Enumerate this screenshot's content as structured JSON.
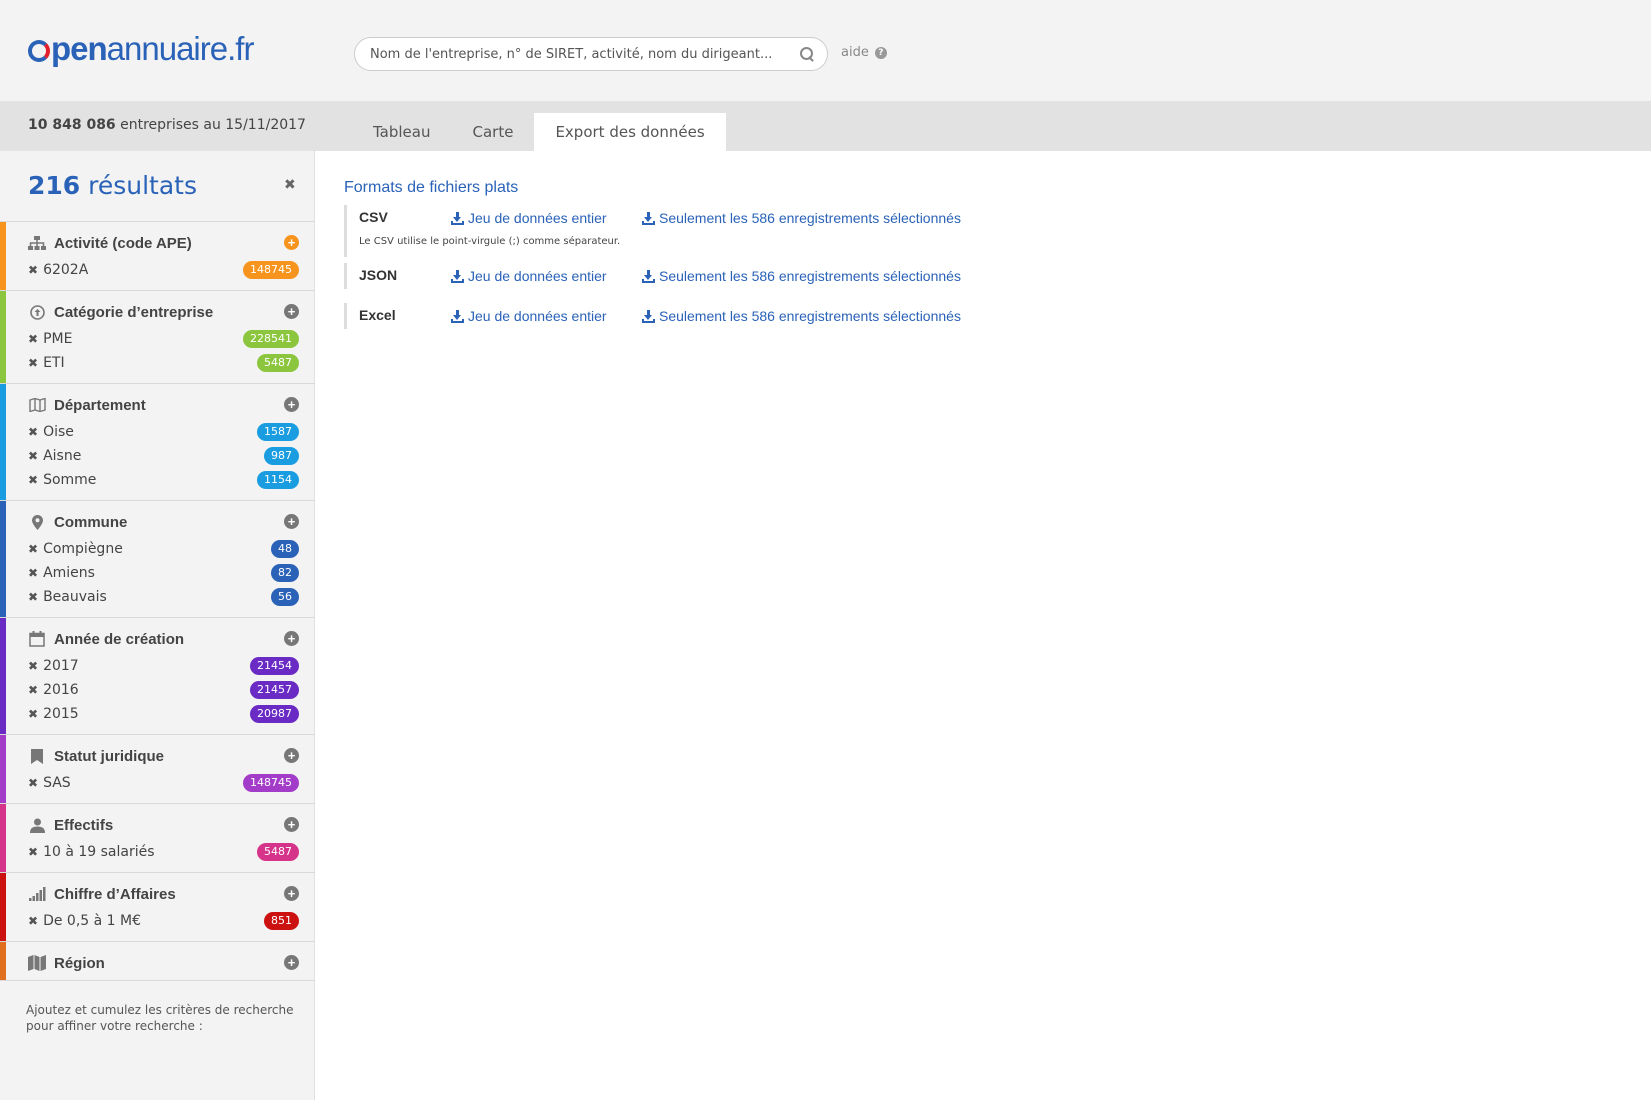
{
  "header": {
    "logo_open": "pen",
    "logo_rest": "annuaire.fr",
    "search_placeholder": "Nom de l'entreprise, n° de SIRET, activité, nom du dirigeant...",
    "help_label": "aide",
    "help_icon": "?"
  },
  "subbar": {
    "count_number": "10 848 086",
    "count_text": " entreprises au 15/11/2017",
    "tabs": [
      {
        "label": "Tableau",
        "active": false
      },
      {
        "label": "Carte",
        "active": false
      },
      {
        "label": "Export des données",
        "active": true
      }
    ]
  },
  "sidebar": {
    "results_number": "216",
    "results_label": " résultats",
    "close": "✖",
    "groups": [
      {
        "title": "Activité (code APE)",
        "icon": "sitemap-icon",
        "color": "#f7941d",
        "plus_color": "#f7941d",
        "items": [
          {
            "label": "6202A",
            "count": "148745"
          }
        ]
      },
      {
        "title": "Catégorie d’entreprise",
        "icon": "arrow-circle-up-icon",
        "color": "#8cc63f",
        "items": [
          {
            "label": "PME",
            "count": "228541"
          },
          {
            "label": "ETI",
            "count": "5487"
          }
        ]
      },
      {
        "title": "Département",
        "icon": "map-outline-icon",
        "color": "#1a9de0",
        "items": [
          {
            "label": "Oise",
            "count": "1587"
          },
          {
            "label": "Aisne",
            "count": "987"
          },
          {
            "label": "Somme",
            "count": "1154"
          }
        ]
      },
      {
        "title": "Commune",
        "icon": "map-marker-icon",
        "color": "#2a62b8",
        "items": [
          {
            "label": "Compiègne",
            "count": "48"
          },
          {
            "label": "Amiens",
            "count": "82"
          },
          {
            "label": "Beauvais",
            "count": "56"
          }
        ]
      },
      {
        "title": "Année de création",
        "icon": "calendar-icon",
        "color": "#6a2bc4",
        "items": [
          {
            "label": "2017",
            "count": "21454"
          },
          {
            "label": "2016",
            "count": "21457"
          },
          {
            "label": "2015",
            "count": "20987"
          }
        ]
      },
      {
        "title": "Statut juridique",
        "icon": "bookmark-icon",
        "color": "#a33cc8",
        "items": [
          {
            "label": "SAS",
            "count": "148745"
          }
        ]
      },
      {
        "title": "Effectifs",
        "icon": "user-icon",
        "color": "#d6338a",
        "items": [
          {
            "label": "10 à 19 salariés",
            "count": "5487"
          }
        ]
      },
      {
        "title": "Chiffre d’Affaires",
        "icon": "signal-icon",
        "color": "#cc1111",
        "items": [
          {
            "label": "De 0,5 à 1 M€",
            "count": "851"
          }
        ]
      },
      {
        "title": "Région",
        "icon": "map-icon",
        "color": "#e07020",
        "items": []
      }
    ],
    "hint": "Ajoutez et cumulez les critères de recherche pour affiner votre recherche :"
  },
  "main": {
    "title": "Formats de fichiers plats",
    "formats": [
      {
        "name": "CSV",
        "full": "Jeu de données entier",
        "selected": "Seulement les 586 enregistrements sélectionnés",
        "note": "Le CSV utilise le point-virgule (;) comme séparateur."
      },
      {
        "name": "JSON",
        "full": "Jeu de données entier",
        "selected": "Seulement les 586 enregistrements sélectionnés",
        "note": ""
      },
      {
        "name": "Excel",
        "full": "Jeu de données entier",
        "selected": "Seulement les 586 enregistrements sélectionnés",
        "note": ""
      }
    ]
  }
}
